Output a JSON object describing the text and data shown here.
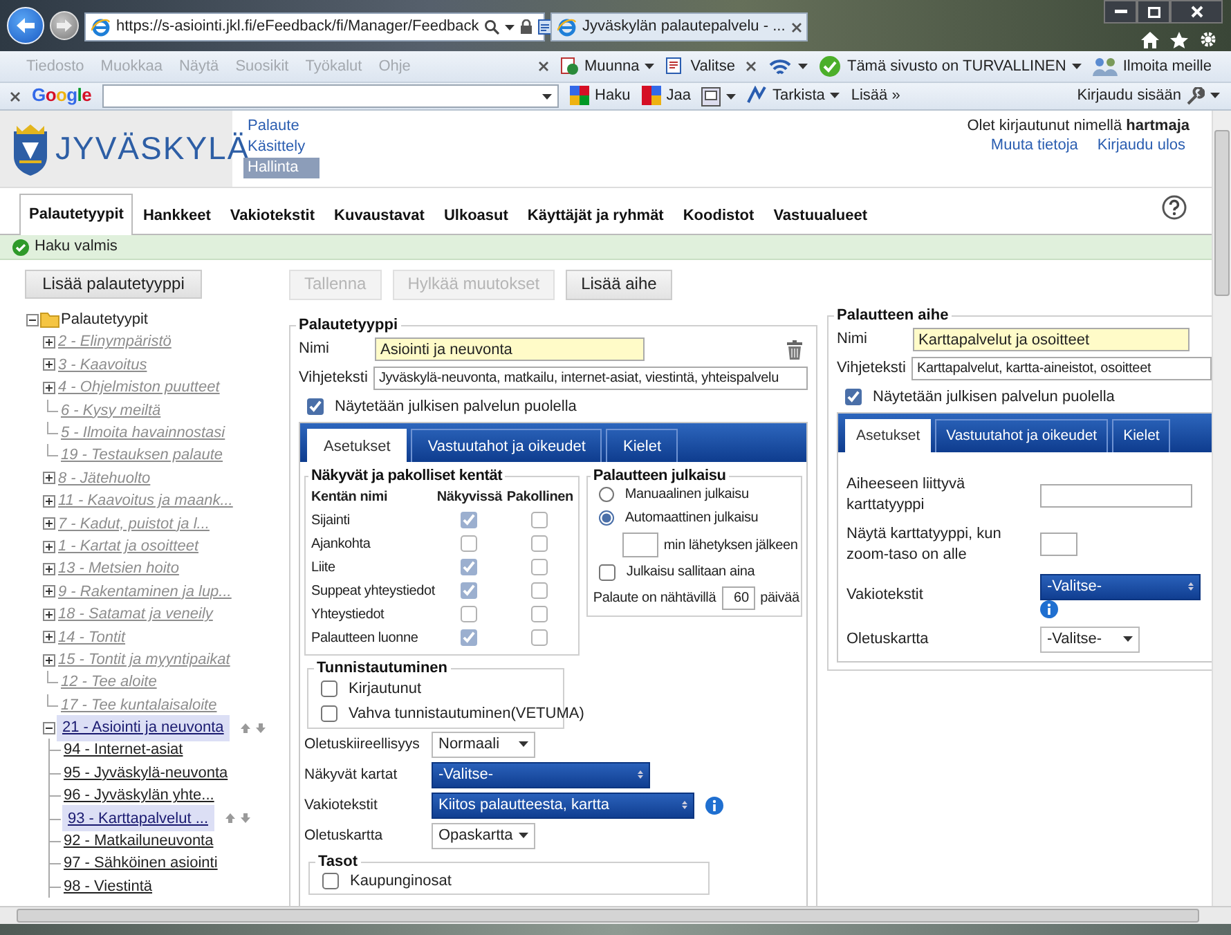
{
  "browser": {
    "address": "https://s-asiointi.jkl.fi/eFeedback/fi/Manager/Feedback",
    "tab_title": "Jyväskylän palautepalvelu - ...",
    "menu": [
      "Tiedosto",
      "Muokkaa",
      "Näytä",
      "Suosikit",
      "Työkalut",
      "Ohje"
    ],
    "tools": [
      {
        "label": "Muunna",
        "kind": "convert",
        "dropdown": true
      },
      {
        "label": "Valitse",
        "kind": "select",
        "dropdown": false
      }
    ],
    "security": "Tämä sivusto on TURVALLINEN",
    "report": "Ilmoita meille",
    "google": {
      "logo": "Google",
      "actions": [
        {
          "label": "Haku",
          "kind": "search",
          "dropdown": false
        },
        {
          "label": "Jaa",
          "kind": "share",
          "dropdown": false
        },
        {
          "kind": "screen",
          "dropdown": true
        },
        {
          "label": "Tarkista",
          "kind": "spell",
          "dropdown": true
        },
        {
          "label": "Lisää »",
          "kind": "more",
          "dropdown": false
        }
      ],
      "signin": "Kirjaudu sisään"
    }
  },
  "header": {
    "logo": "JYVÄSKYLÄ",
    "nav": [
      {
        "label": "Palaute",
        "selected": false
      },
      {
        "label": "Käsittely",
        "selected": false
      },
      {
        "label": "Hallinta",
        "selected": true
      }
    ],
    "login_text": "Olet kirjautunut nimellä **hartmaja**",
    "links": [
      "Muuta tietoja",
      "Kirjaudu ulos"
    ]
  },
  "tabs": [
    {
      "label": "Palautetyypit",
      "selected": true
    },
    {
      "label": "Hankkeet",
      "selected": false
    },
    {
      "label": "Vakiotekstit",
      "selected": false
    },
    {
      "label": "Kuvaustavat",
      "selected": false
    },
    {
      "label": "Ulkoasut",
      "selected": false
    },
    {
      "label": "Käyttäjät ja ryhmät",
      "selected": false
    },
    {
      "label": "Koodistot",
      "selected": false
    },
    {
      "label": "Vastuualueet",
      "selected": false
    }
  ],
  "status": "Haku valmis",
  "sidebar": {
    "add_button": "Lisää palautetyyppi",
    "tree": {
      "label": "Palautetyypit",
      "kind": "root",
      "expanded": true,
      "active": true,
      "selected": false,
      "children": [
        {
          "label": "2 - Elinympäristö",
          "kind": "branch",
          "expanded": false,
          "active": false,
          "selected": false
        },
        {
          "label": "3 - Kaavoitus",
          "kind": "branch",
          "expanded": false,
          "active": false,
          "selected": false
        },
        {
          "label": "4 - Ohjelmiston puutteet",
          "kind": "branch",
          "expanded": false,
          "active": false,
          "selected": false
        },
        {
          "label": "6 - Kysy meiltä",
          "kind": "leaf",
          "active": false,
          "selected": false
        },
        {
          "label": "5 - Ilmoita havainnostasi",
          "kind": "leaf",
          "active": false,
          "selected": false
        },
        {
          "label": "19 - Testauksen palaute",
          "kind": "leaf",
          "active": false,
          "selected": false
        },
        {
          "label": "8 - Jätehuolto",
          "kind": "branch",
          "expanded": false,
          "active": false,
          "selected": false
        },
        {
          "label": "11 - Kaavoitus ja maank...",
          "kind": "branch",
          "expanded": false,
          "active": false,
          "selected": false
        },
        {
          "label": "7 - Kadut, puistot ja l...",
          "kind": "branch",
          "expanded": false,
          "active": false,
          "selected": false
        },
        {
          "label": "1 - Kartat ja osoitteet",
          "kind": "branch",
          "expanded": false,
          "active": false,
          "selected": false
        },
        {
          "label": "13 - Metsien hoito",
          "kind": "branch",
          "expanded": false,
          "active": false,
          "selected": false
        },
        {
          "label": "9 - Rakentaminen ja lup...",
          "kind": "branch",
          "expanded": false,
          "active": false,
          "selected": false
        },
        {
          "label": "18 - Satamat ja veneily",
          "kind": "branch",
          "expanded": false,
          "active": false,
          "selected": false
        },
        {
          "label": "14 - Tontit",
          "kind": "branch",
          "expanded": false,
          "active": false,
          "selected": false
        },
        {
          "label": "15 - Tontit ja myyntipaikat",
          "kind": "branch",
          "expanded": false,
          "active": false,
          "selected": false
        },
        {
          "label": "12 - Tee aloite",
          "kind": "leaf",
          "active": false,
          "selected": false
        },
        {
          "label": "17 - Tee kuntalaisaloite",
          "kind": "leaf",
          "active": false,
          "selected": false
        },
        {
          "label": "21 - Asiointi ja neuvonta",
          "kind": "branch",
          "expanded": true,
          "active": true,
          "selected": true,
          "children": [
            {
              "label": "94 - Internet-asiat",
              "kind": "leaf",
              "active": true,
              "selected": false
            },
            {
              "label": "95 - Jyväskylä-neuvonta",
              "kind": "leaf",
              "active": true,
              "selected": false
            },
            {
              "label": "96 - Jyväskylän yhte...",
              "kind": "leaf",
              "active": true,
              "selected": false
            },
            {
              "label": "93 - Karttapalvelut ...",
              "kind": "leaf",
              "active": true,
              "selected": true
            },
            {
              "label": "92 - Matkailuneuvonta",
              "kind": "leaf",
              "active": true,
              "selected": false
            },
            {
              "label": "97 - Sähköinen asiointi",
              "kind": "leaf",
              "active": true,
              "selected": false
            },
            {
              "label": "98 - Viestintä",
              "kind": "leaf",
              "active": true,
              "selected": false
            }
          ]
        }
      ]
    }
  },
  "editor": {
    "buttons": [
      {
        "label": "Tallenna",
        "disabled": true
      },
      {
        "label": "Hylkää muutokset",
        "disabled": true
      },
      {
        "label": "Lisää aihe",
        "disabled": false
      }
    ],
    "title": "Palautetyyppi",
    "name_label": "Nimi",
    "name_value": "Asiointi ja neuvonta",
    "hint_field": {
      "label": "Vihjeteksti",
      "value": "Jyväskylä-neuvonta, matkailu, internet-asiat, viestintä, yhteispalvelu"
    },
    "public": {
      "label": "Näytetään julkisen palvelun puolella",
      "checked": true
    },
    "tabs": [
      {
        "label": "Asetukset",
        "selected": true
      },
      {
        "label": "Vastuutahot ja oikeudet",
        "selected": false
      },
      {
        "label": "Kielet",
        "selected": false
      }
    ],
    "fields": {
      "title": "Näkyvät ja pakolliset kentät",
      "columns": [
        "Kentän nimi",
        "Näkyvissä",
        "Pakollinen"
      ],
      "rows": [
        {
          "name": "Sijainti",
          "visible": true,
          "required": false
        },
        {
          "name": "Ajankohta",
          "visible": false,
          "required": false
        },
        {
          "name": "Liite",
          "visible": true,
          "required": false
        },
        {
          "name": "Suppeat yhteystiedot",
          "visible": true,
          "required": false
        },
        {
          "name": "Yhteystiedot",
          "visible": false,
          "required": false
        },
        {
          "name": "Palautteen luonne",
          "visible": true,
          "required": false
        }
      ]
    },
    "publish": {
      "title": "Palautteen julkaisu",
      "options": [
        {
          "label": "Manuaalinen julkaisu",
          "selected": false
        },
        {
          "label": "Automaattinen julkaisu",
          "selected": true
        }
      ],
      "minutes_suffix": "min lähetyksen jälkeen",
      "always": {
        "label": "Julkaisu sallitaan aina",
        "checked": false
      },
      "visible_label": "Palaute on nähtävillä",
      "visible_days": "60",
      "days_suffix": "päivää"
    },
    "auth": {
      "title": "Tunnistautuminen",
      "options": [
        {
          "label": "Kirjautunut",
          "checked": false
        },
        {
          "label": "Vahva tunnistautuminen(VETUMA)",
          "checked": false
        }
      ]
    },
    "selects": [
      {
        "label": "Oletuskiireellisyys",
        "value": "Normaali",
        "kind": "dropdown",
        "info": false
      },
      {
        "label": "Näkyvät kartat",
        "value": "-Valitse-",
        "kind": "multi",
        "info": false
      },
      {
        "label": "Vakiotekstit",
        "value": "Kiitos palautteesta, kartta",
        "kind": "multi",
        "info": true
      },
      {
        "label": "Oletuskartta",
        "value": "Opaskartta",
        "kind": "dropdown",
        "info": false
      }
    ],
    "layers": {
      "title": "Tasot",
      "items": [
        {
          "label": "Kaupunginosat",
          "checked": false
        }
      ]
    }
  },
  "topic": {
    "title": "Palautteen aihe",
    "name_label": "Nimi",
    "name_value": "Karttapalvelut ja osoitteet",
    "hint_field": {
      "label": "Vihjeteksti",
      "value": "Karttapalvelut, kartta-aineistot, osoitteet"
    },
    "public": {
      "label": "Näytetään julkisen palvelun puolella",
      "checked": true
    },
    "tabs": [
      {
        "label": "Asetukset",
        "selected": true
      },
      {
        "label": "Vastuutahot ja oikeudet",
        "selected": false
      },
      {
        "label": "Kielet",
        "selected": false
      }
    ],
    "fields": [
      {
        "label": "Aiheeseen liittyvä karttatyyppi",
        "kind": "text",
        "info": false
      },
      {
        "label": "Näytä karttatyyppi, kun zoom-taso on alle",
        "kind": "short",
        "info": false
      },
      {
        "label": "Vakiotekstit",
        "kind": "multi",
        "value": "-Valitse-",
        "info": true
      },
      {
        "label": "Oletuskartta",
        "kind": "dropdown",
        "value": "-Valitse-",
        "info": false
      }
    ]
  }
}
